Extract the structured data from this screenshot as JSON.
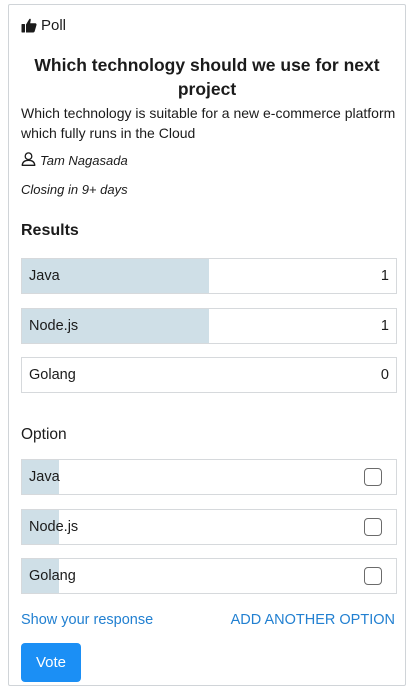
{
  "header": {
    "label": "Poll",
    "icon": "thumbs-up-icon"
  },
  "poll": {
    "title": "Which technology should we use for next project",
    "description": "Which technology is suitable for a new e-commerce platform which fully runs in the Cloud",
    "author": "Tam Nagasada",
    "author_icon": "user-icon",
    "closing": "Closing in 9+ days"
  },
  "results": {
    "heading": "Results",
    "rows": [
      {
        "label": "Java",
        "count": "1",
        "share": 0.5
      },
      {
        "label": "Node.js",
        "count": "1",
        "share": 0.5
      },
      {
        "label": "Golang",
        "count": "0",
        "share": 0
      }
    ]
  },
  "options": {
    "heading": "Option",
    "rows": [
      {
        "label": "Java",
        "checked": false
      },
      {
        "label": "Node.js",
        "checked": false
      },
      {
        "label": "Golang",
        "checked": false
      }
    ]
  },
  "links": {
    "show_response": "Show your response",
    "add_option": "ADD ANOTHER OPTION"
  },
  "vote_label": "Vote",
  "colors": {
    "accent": "#1b8ff5",
    "link": "#2280d1",
    "bar_fill": "#cfdfe7"
  }
}
